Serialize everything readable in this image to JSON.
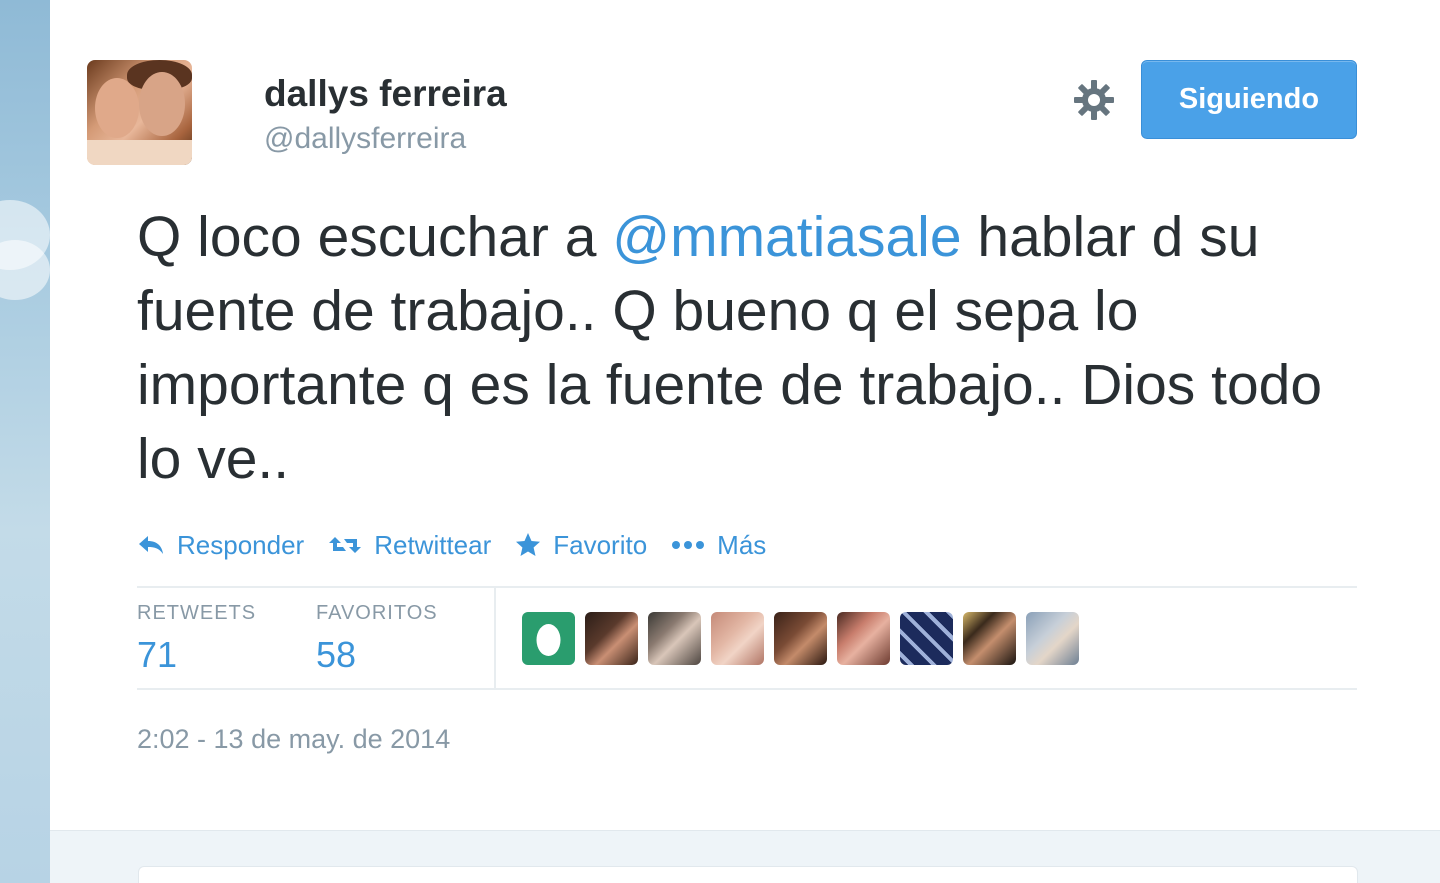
{
  "user": {
    "name": "dallys ferreira",
    "handle": "@dallysferreira"
  },
  "follow_button": {
    "label": "Siguiendo"
  },
  "tweet": {
    "text_before": "Q loco escuchar a ",
    "mention": "@mmatiasale",
    "text_after": " hablar d su fuente de trabajo.. Q bueno q el sepa lo importante q es la fuente de trabajo.. Dios todo lo ve.."
  },
  "actions": {
    "reply": {
      "label": "Responder",
      "icon": "reply-icon"
    },
    "retweet": {
      "label": "Retwittear",
      "icon": "retweet-icon"
    },
    "favorite": {
      "label": "Favorito",
      "icon": "star-icon"
    },
    "more": {
      "label": "Más",
      "icon": "more-dots-icon"
    }
  },
  "stats": {
    "retweets": {
      "label": "RETWEETS",
      "value": "71"
    },
    "favorites": {
      "label": "FAVORITOS",
      "value": "58"
    }
  },
  "timestamp": "2:02 - 13 de may. de 2014",
  "colors": {
    "accent": "#3b94d9",
    "button": "#4aa1e8",
    "text": "#292f33",
    "muted": "#8899a6"
  }
}
